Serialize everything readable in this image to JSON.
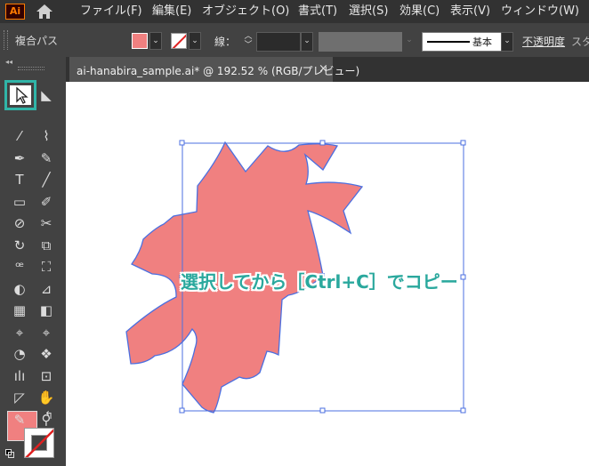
{
  "app": {
    "logo_text": "Ai"
  },
  "menu": {
    "items": [
      {
        "label": "ファイル(F)"
      },
      {
        "label": "編集(E)"
      },
      {
        "label": "オブジェクト(O)"
      },
      {
        "label": "書式(T)"
      },
      {
        "label": "選択(S)"
      },
      {
        "label": "効果(C)"
      },
      {
        "label": "表示(V)"
      },
      {
        "label": "ウィンドウ(W)"
      }
    ]
  },
  "control_bar": {
    "object_type": "複合パス",
    "fill_color": "#f08080",
    "stroke_label": "線：",
    "stroke_weight": "",
    "brush_label": "基本",
    "opacity_label": "不透明度",
    "style_label": "スタ"
  },
  "document": {
    "tab_title": "ai-hanabira_sample.ai* @ 192.52 % (RGB/プレビュー)",
    "close_glyph": "×"
  },
  "artwork": {
    "shape": "sakura-petal-flower",
    "fill_color": "#f08080",
    "selection_color": "#4b6fe0"
  },
  "annotation": {
    "text": "選択してから［Ctrl+C］でコピー",
    "color": "#2aa89d"
  },
  "toolbox": {
    "highlight_color": "#30b5a8",
    "tools": [
      "selection-tool-icon",
      "direct-selection-tool-icon",
      "magic-wand-tool-icon",
      "lasso-tool-icon",
      "pen-tool-icon",
      "curvature-tool-icon",
      "type-tool-icon",
      "line-tool-icon",
      "rectangle-tool-icon",
      "paintbrush-tool-icon",
      "shaper-tool-icon",
      "scissors-tool-icon",
      "rotate-tool-icon",
      "scale-tool-icon",
      "warp-tool-icon",
      "free-transform-tool-icon",
      "shape-builder-tool-icon",
      "perspective-grid-tool-icon",
      "mesh-tool-icon",
      "gradient-tool-icon",
      "eyedropper-tool-icon",
      "eyedropper-alt-tool-icon",
      "blend-tool-icon",
      "symbol-sprayer-tool-icon",
      "column-graph-tool-icon",
      "artboard-tool-icon",
      "slice-tool-icon",
      "hand-tool-icon",
      "puppet-warp-tool-icon",
      "zoom-tool-icon"
    ]
  }
}
